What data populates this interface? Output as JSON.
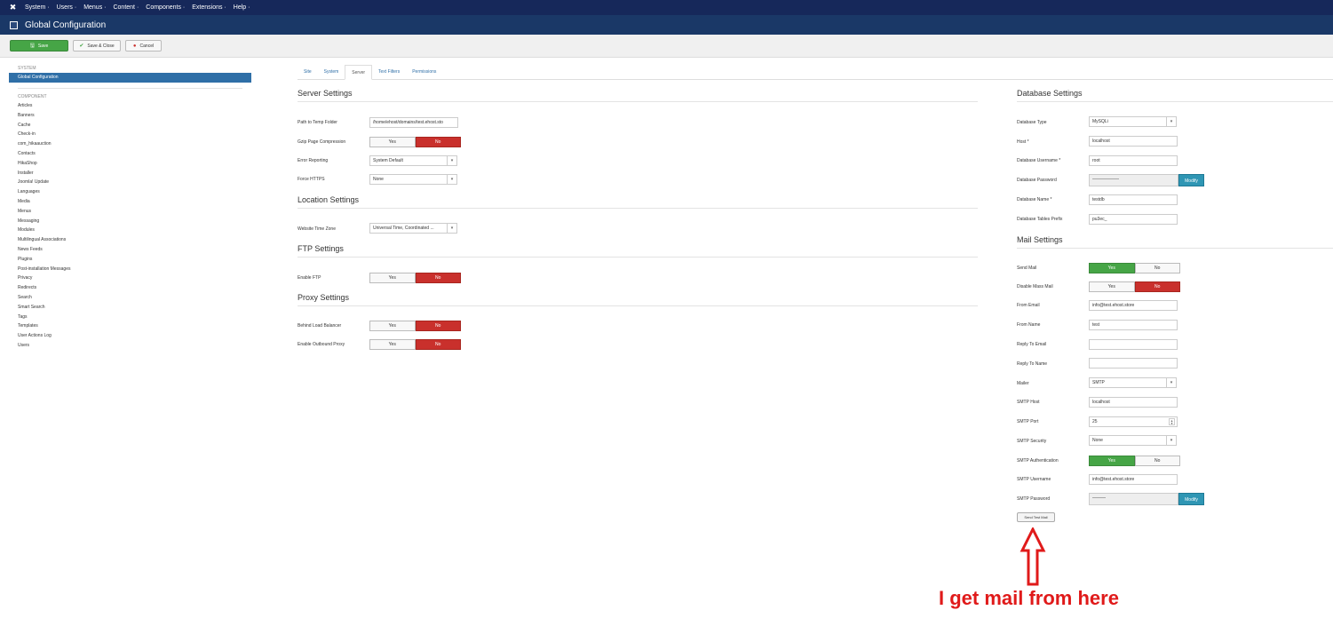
{
  "topnav": {
    "logo_icon": "joomla-logo-icon",
    "items": [
      "System ·",
      "Users ·",
      "Menus ·",
      "Content ·",
      "Components ·",
      "Extensions ·",
      "Help ·"
    ]
  },
  "header": {
    "title": "Global Configuration",
    "icon": "grid-icon"
  },
  "toolbar": {
    "save": "Save",
    "save_close": "Save & Close",
    "cancel": "Cancel"
  },
  "sidebar": {
    "system_head": "SYSTEM",
    "active": "Global Configuration",
    "component_head": "COMPONENT",
    "items": [
      "Articles",
      "Banners",
      "Cache",
      "Check-in",
      "com_hikaauction",
      "Contacts",
      "HikaShop",
      "Installer",
      "Joomla! Update",
      "Languages",
      "Media",
      "Menus",
      "Messaging",
      "Modules",
      "Multilingual Associations",
      "News Feeds",
      "Plugins",
      "Post-installation Messages",
      "Privacy",
      "Redirects",
      "Search",
      "Smart Search",
      "Tags",
      "Templates",
      "User Actions Log",
      "Users"
    ]
  },
  "tabs": [
    "Site",
    "System",
    "Server",
    "Text Filters",
    "Permissions"
  ],
  "server": {
    "title": "Server Settings",
    "temp_label": "Path to Temp Folder",
    "temp_value": "/home/ehost/domains/test.ehost.sto",
    "gzip_label": "Gzip Page Compression",
    "error_label": "Error Reporting",
    "error_value": "System Default",
    "https_label": "Force HTTPS",
    "https_value": "None"
  },
  "location": {
    "title": "Location Settings",
    "tz_label": "Website Time Zone",
    "tz_value": "Universal Time, Coordinated ..."
  },
  "ftp": {
    "title": "FTP Settings",
    "enable_label": "Enable FTP"
  },
  "proxy": {
    "title": "Proxy Settings",
    "balancer_label": "Behind Load Balancer",
    "outbound_label": "Enable Outbound Proxy"
  },
  "toggle": {
    "yes": "Yes",
    "no": "No"
  },
  "database": {
    "title": "Database Settings",
    "type_label": "Database Type",
    "type_value": "MySQLi",
    "host_label": "Host *",
    "host_value": "localhost",
    "user_label": "Database Username *",
    "user_value": "root",
    "pass_label": "Database Password",
    "pass_value": "——————",
    "modify": "Modify",
    "name_label": "Database Name *",
    "name_value": "testdb",
    "prefix_label": "Database Tables Prefix",
    "prefix_value": "pu3ec_"
  },
  "mail": {
    "title": "Mail Settings",
    "send_label": "Send Mail",
    "mass_label": "Disable Mass Mail",
    "from_email_label": "From Email",
    "from_email_value": "info@test.ehost.store",
    "from_name_label": "From Name",
    "from_name_value": "test",
    "reply_email_label": "Reply To Email",
    "reply_name_label": "Reply To Name",
    "mailer_label": "Mailer",
    "mailer_value": "SMTP",
    "host_label": "SMTP Host",
    "host_value": "localhost",
    "port_label": "SMTP Port",
    "port_value": "25",
    "security_label": "SMTP Security",
    "security_value": "None",
    "auth_label": "SMTP Authentication",
    "user_label": "SMTP Username",
    "user_value": "info@test.ehost.store",
    "pass_label": "SMTP Password",
    "pass_value": "———",
    "test_button": "Send Test Mail"
  },
  "annotation": {
    "text": "I get mail from here",
    "color": "#e01a1a"
  }
}
